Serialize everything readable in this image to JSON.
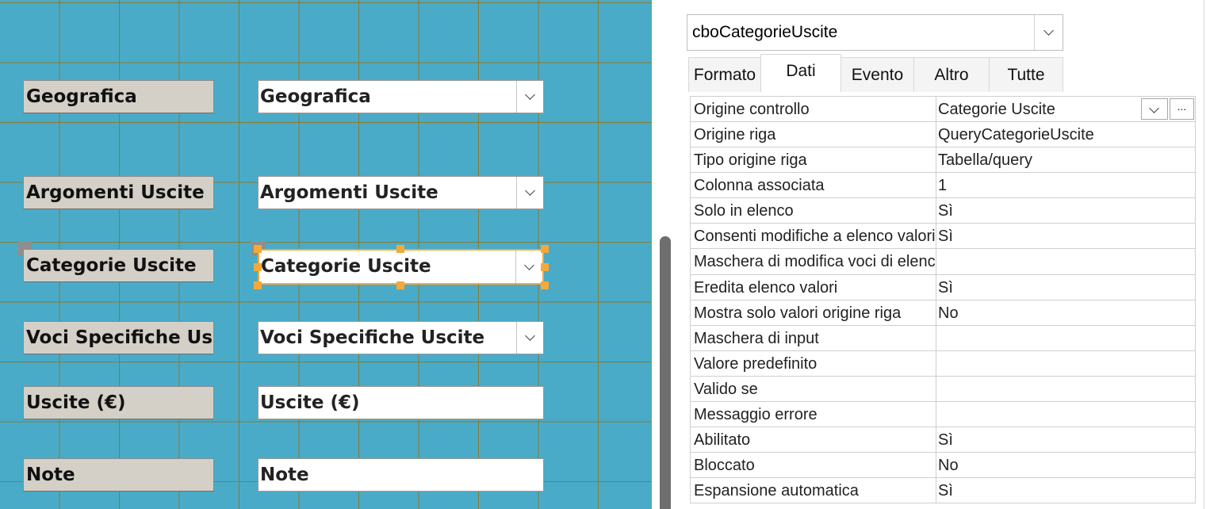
{
  "form": {
    "fields": [
      {
        "label": "Geografica",
        "control": "Geografica",
        "type": "combo"
      },
      {
        "label": "Argomenti Uscite",
        "control": "Argomenti Uscite",
        "type": "combo"
      },
      {
        "label": "Categorie Uscite",
        "control": "Categorie Uscite",
        "type": "combo",
        "selected": true
      },
      {
        "label": "Voci Specifiche Usci",
        "control": "Voci Specifiche Uscite",
        "type": "combo"
      },
      {
        "label": "Uscite (€)",
        "control": "Uscite (€)",
        "type": "text"
      },
      {
        "label": "Note",
        "control": "Note",
        "type": "text"
      }
    ],
    "colors": {
      "canvas": "#4aabc8",
      "grid": "#8a7a2e",
      "selection": "#f4a93a"
    }
  },
  "property_sheet": {
    "object_selector": "cboCategorieUscite",
    "tabs": [
      "Formato",
      "Dati",
      "Evento",
      "Altro",
      "Tutte"
    ],
    "active_tab": "Dati",
    "properties": [
      {
        "name": "Origine controllo",
        "value": "Categorie Uscite"
      },
      {
        "name": "Origine riga",
        "value": "QueryCategorieUscite"
      },
      {
        "name": "Tipo origine riga",
        "value": "Tabella/query"
      },
      {
        "name": "Colonna associata",
        "value": "1"
      },
      {
        "name": "Solo in elenco",
        "value": "Sì"
      },
      {
        "name": "Consenti modifiche a elenco valori",
        "value": "Sì"
      },
      {
        "name": "Maschera di modifica voci di elenco",
        "value": ""
      },
      {
        "name": "Eredita elenco valori",
        "value": "Sì"
      },
      {
        "name": "Mostra solo valori origine riga",
        "value": "No"
      },
      {
        "name": "Maschera di input",
        "value": ""
      },
      {
        "name": "Valore predefinito",
        "value": ""
      },
      {
        "name": "Valido se",
        "value": ""
      },
      {
        "name": "Messaggio errore",
        "value": ""
      },
      {
        "name": "Abilitato",
        "value": "Sì"
      },
      {
        "name": "Bloccato",
        "value": "No"
      },
      {
        "name": "Espansione automatica",
        "value": "Sì"
      }
    ],
    "build_button": "..."
  }
}
